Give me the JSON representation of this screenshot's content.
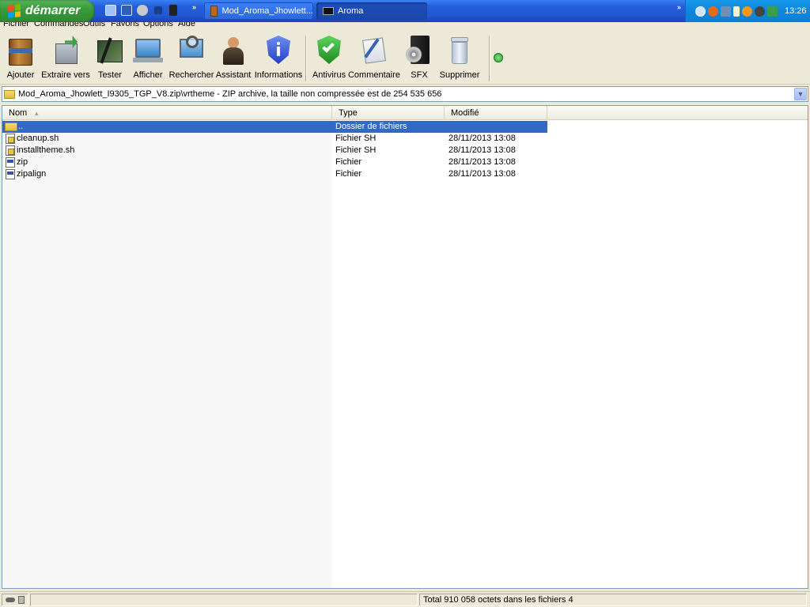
{
  "taskbar": {
    "start_label": "démarrer",
    "quicklaunch_icons": [
      "network-icon",
      "desktop-icon",
      "media-icon",
      "app-icon",
      "phone-icon"
    ],
    "chevron": "»",
    "buttons": [
      {
        "label": "Mod_Aroma_Jhowlett...",
        "icon": "winrar-icon",
        "active": false
      },
      {
        "label": "Aroma",
        "icon": "terminal-icon",
        "active": true
      }
    ],
    "tray_icons": [
      "back-arrow-icon",
      "firefox-icon",
      "network-icon",
      "usb-icon",
      "orange-app-icon",
      "shield-icon",
      "network-status-icon"
    ],
    "clock": "13:26"
  },
  "menu": [
    "Fichier",
    "Commandes",
    "Outils",
    "Favoris",
    "Options",
    "Aide"
  ],
  "toolbar": {
    "tools": [
      {
        "label": "Ajouter",
        "icon": "archive-add-icon"
      },
      {
        "label": "Extraire vers",
        "icon": "extract-icon"
      },
      {
        "label": "Tester",
        "icon": "test-icon"
      },
      {
        "label": "Afficher",
        "icon": "view-icon"
      },
      {
        "label": "Rechercher",
        "icon": "search-icon"
      },
      {
        "label": "Assistant",
        "icon": "wizard-icon"
      },
      {
        "label": "Informations",
        "icon": "info-icon"
      },
      {
        "label": "Antivirus",
        "icon": "antivirus-icon"
      },
      {
        "label": "Commentaire",
        "icon": "comment-icon"
      },
      {
        "label": "SFX",
        "icon": "sfx-icon"
      },
      {
        "label": "Supprimer",
        "icon": "delete-icon"
      }
    ]
  },
  "path": {
    "text": "Mod_Aroma_Jhowlett_I9305_TGP_V8.zip\\vrtheme - ZIP archive, la taille non compressée est de 254 535 656"
  },
  "list": {
    "columns": [
      {
        "label": "Nom",
        "sort": "▲"
      },
      {
        "label": "Type"
      },
      {
        "label": "Modifié"
      }
    ],
    "rows": [
      {
        "name": "..",
        "type": "Dossier de fichiers",
        "modified": "",
        "icon": "folder",
        "selected": true
      },
      {
        "name": "cleanup.sh",
        "type": "Fichier SH",
        "modified": "28/11/2013 13:08",
        "icon": "sh",
        "selected": false
      },
      {
        "name": "installtheme.sh",
        "type": "Fichier SH",
        "modified": "28/11/2013 13:08",
        "icon": "sh",
        "selected": false
      },
      {
        "name": "zip",
        "type": "Fichier",
        "modified": "28/11/2013 13:08",
        "icon": "bin",
        "selected": false
      },
      {
        "name": "zipalign",
        "type": "Fichier",
        "modified": "28/11/2013 13:08",
        "icon": "bin",
        "selected": false
      }
    ]
  },
  "status": {
    "text": "Total 910 058 octets dans les fichiers 4"
  }
}
